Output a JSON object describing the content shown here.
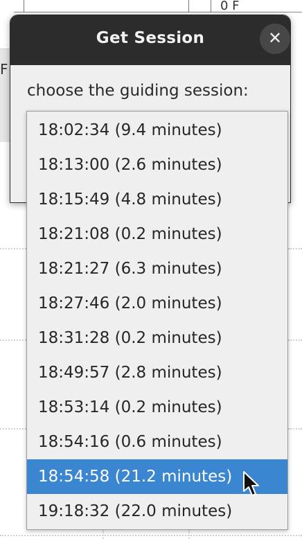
{
  "background": {
    "top_fragment_text": "0 F",
    "left_fragment_text": "F"
  },
  "dialog": {
    "title": "Get Session",
    "close_label": "✕",
    "prompt": "choose the guiding session:"
  },
  "sessions": [
    {
      "label": "18:02:34 (9.4 minutes)",
      "selected": false
    },
    {
      "label": "18:13:00 (2.6 minutes)",
      "selected": false
    },
    {
      "label": "18:15:49 (4.8 minutes)",
      "selected": false
    },
    {
      "label": "18:21:08 (0.2 minutes)",
      "selected": false
    },
    {
      "label": "18:21:27 (6.3 minutes)",
      "selected": false
    },
    {
      "label": "18:27:46 (2.0 minutes)",
      "selected": false
    },
    {
      "label": "18:31:28 (0.2 minutes)",
      "selected": false
    },
    {
      "label": "18:49:57 (2.8 minutes)",
      "selected": false
    },
    {
      "label": "18:53:14 (0.2 minutes)",
      "selected": false
    },
    {
      "label": "18:54:16 (0.6 minutes)",
      "selected": false
    },
    {
      "label": "18:54:58 (21.2 minutes)",
      "selected": true
    },
    {
      "label": "19:18:32 (22.0 minutes)",
      "selected": false
    }
  ],
  "colors": {
    "titlebar": "#2c2c2c",
    "selection": "#3a86d0",
    "dialog_bg": "#efefef"
  },
  "icons": {
    "close": "close-icon",
    "cursor": "mouse-pointer-icon"
  }
}
